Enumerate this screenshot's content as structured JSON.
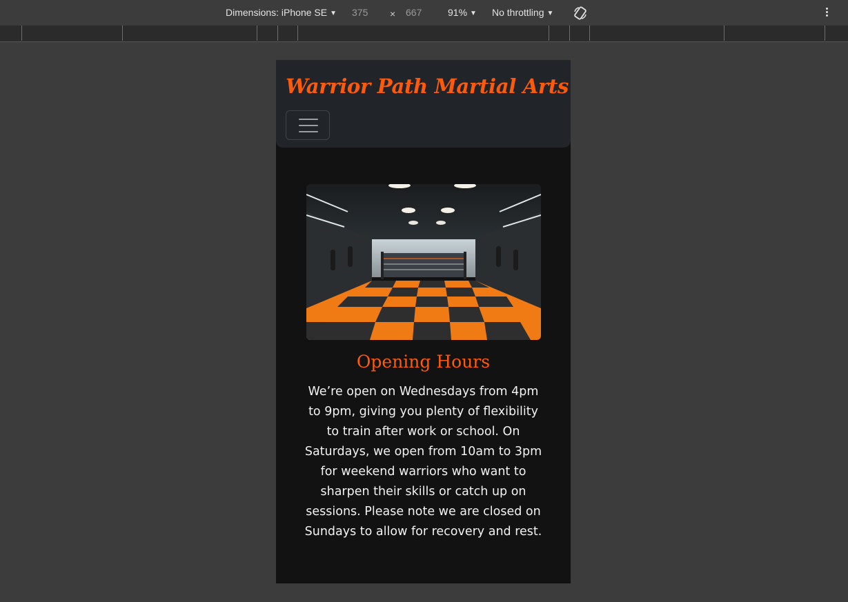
{
  "devtools": {
    "dimensions_label": "Dimensions: iPhone SE",
    "width_value": "375",
    "times": "×",
    "height_value": "667",
    "zoom": "91%",
    "throttling": "No throttling",
    "rotate_icon": "rotate-device-icon",
    "more_icon": "more-options-icon"
  },
  "site": {
    "brand": "Warrior Path Martial Arts",
    "menu_icon": "hamburger-menu-icon",
    "hero_image_alt": "martial arts gym interior",
    "opening_hours": {
      "title": "Opening Hours",
      "body": "We’re open on Wednesdays from 4pm to 9pm, giving you plenty of flexibility to train after work or school. On Saturdays, we open from 10am to 3pm for weekend warriors who want to sharpen their skills or catch up on sessions. Please note we are closed on Sundays to allow for recovery and rest."
    }
  },
  "colors": {
    "accent": "#ff5a0a",
    "navbar_bg": "#212529",
    "page_bg": "#121212",
    "mat_orange": "#f07a14",
    "mat_dark": "#2e2e2e"
  }
}
